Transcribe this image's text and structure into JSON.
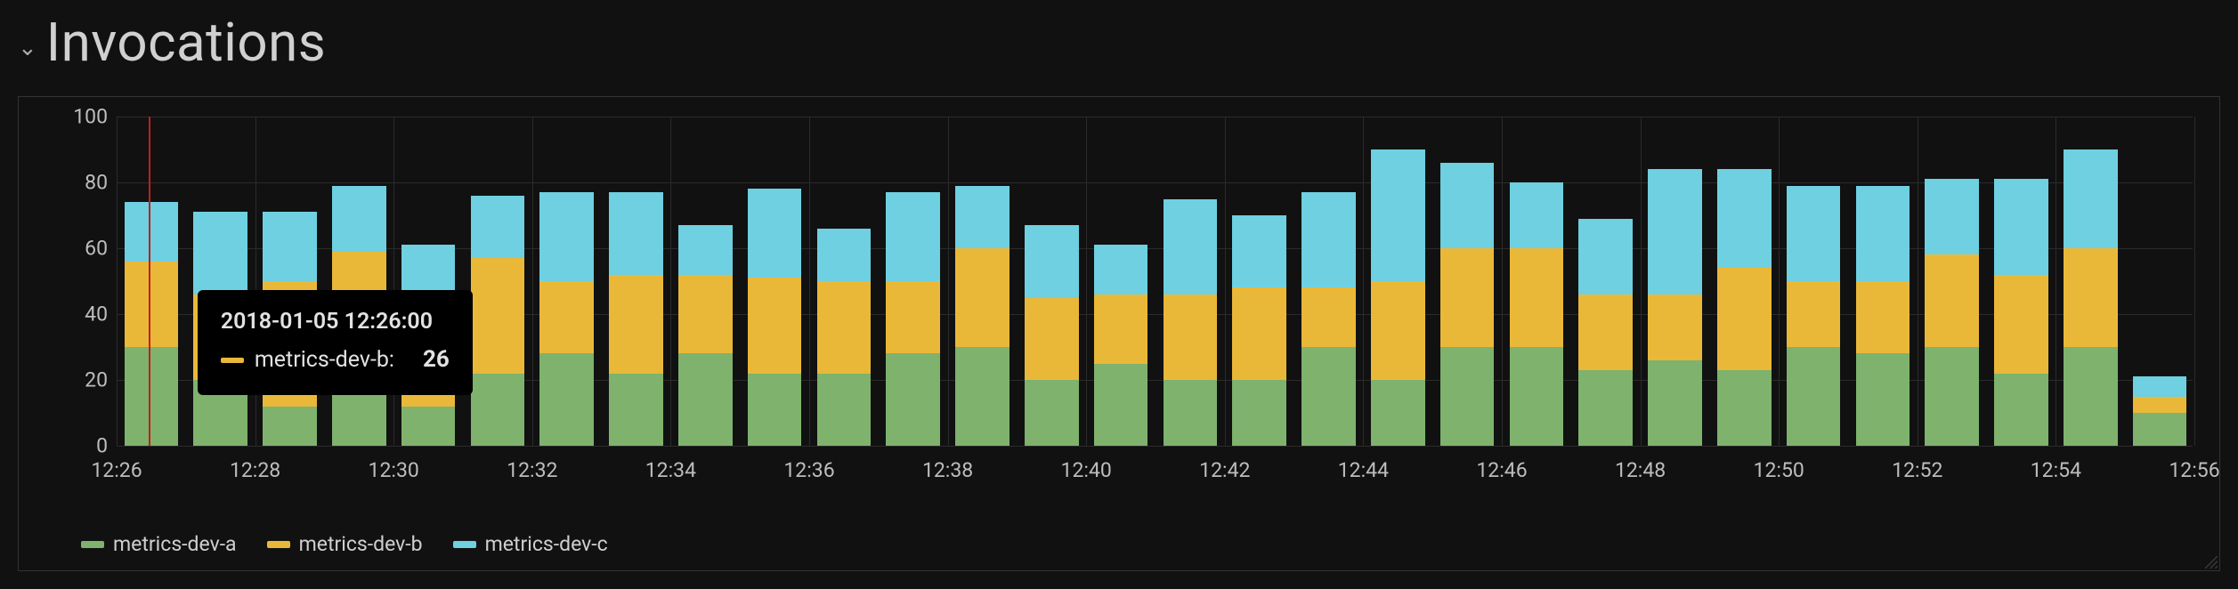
{
  "title": "Invocations",
  "tooltip": {
    "timestamp": "2018-01-05 12:26:00",
    "series_label": "metrics-dev-b:",
    "value": "26",
    "swatch": "#eab839"
  },
  "legend": [
    {
      "name": "metrics-dev-a",
      "color": "#7eb26d"
    },
    {
      "name": "metrics-dev-b",
      "color": "#eab839"
    },
    {
      "name": "metrics-dev-c",
      "color": "#6ed0e0"
    }
  ],
  "y_ticks": [
    0,
    20,
    40,
    60,
    80,
    100
  ],
  "x_ticks": [
    "12:26",
    "12:28",
    "12:30",
    "12:32",
    "12:34",
    "12:36",
    "12:38",
    "12:40",
    "12:42",
    "12:44",
    "12:46",
    "12:48",
    "12:50",
    "12:52",
    "12:54",
    "12:56"
  ],
  "chart_data": {
    "type": "bar",
    "stacked": true,
    "title": "Invocations",
    "xlabel": "",
    "ylabel": "",
    "ylim": [
      0,
      100
    ],
    "categories": [
      "12:26",
      "12:27",
      "12:28",
      "12:29",
      "12:30",
      "12:31",
      "12:32",
      "12:33",
      "12:34",
      "12:35",
      "12:36",
      "12:37",
      "12:38",
      "12:39",
      "12:40",
      "12:41",
      "12:42",
      "12:43",
      "12:44",
      "12:45",
      "12:46",
      "12:47",
      "12:48",
      "12:49",
      "12:50",
      "12:51",
      "12:52",
      "12:53",
      "12:54",
      "12:55"
    ],
    "series": [
      {
        "name": "metrics-dev-a",
        "color": "#7eb26d",
        "values": [
          30,
          20,
          12,
          18,
          12,
          22,
          28,
          22,
          28,
          22,
          22,
          28,
          30,
          20,
          25,
          20,
          20,
          30,
          20,
          30,
          30,
          23,
          26,
          23,
          30,
          28,
          30,
          22,
          30,
          10
        ]
      },
      {
        "name": "metrics-dev-b",
        "color": "#eab839",
        "values": [
          26,
          26,
          38,
          41,
          32,
          35,
          22,
          30,
          24,
          29,
          28,
          22,
          30,
          25,
          21,
          26,
          28,
          18,
          30,
          30,
          30,
          23,
          20,
          31,
          20,
          22,
          28,
          30,
          30,
          5
        ]
      },
      {
        "name": "metrics-dev-c",
        "color": "#6ed0e0",
        "values": [
          18,
          25,
          21,
          20,
          17,
          19,
          27,
          25,
          15,
          27,
          16,
          27,
          19,
          22,
          15,
          29,
          22,
          29,
          40,
          26,
          20,
          23,
          38,
          30,
          29,
          29,
          23,
          29,
          30,
          6
        ]
      }
    ],
    "hover_index": 0
  }
}
